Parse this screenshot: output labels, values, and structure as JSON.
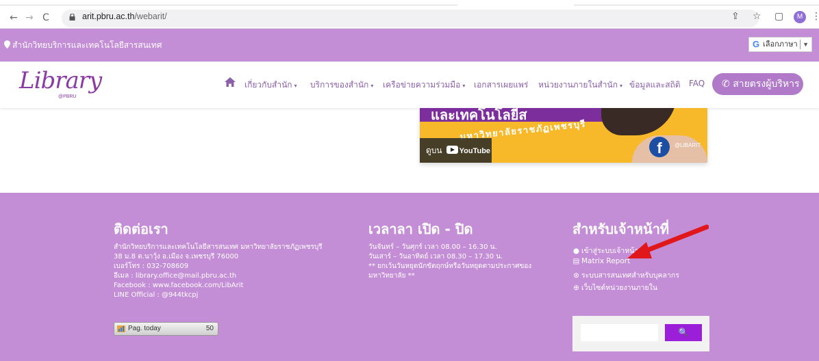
{
  "browser": {
    "url_host": "arit.pbru.ac.th",
    "url_path": "/webarit/",
    "profile_initial": "M"
  },
  "topbar": {
    "title": "สำนักวิทยบริการและเทคโนโลยีสารสนเทศ",
    "language_button": "เลือกภาษา",
    "language_arrow": "▼"
  },
  "nav": {
    "logo": "Library",
    "logo_sub": "@PBRU",
    "items": [
      {
        "label": "เกี่ยวกับสำนัก",
        "dropdown": "▾"
      },
      {
        "label": "บริการของสำนัก",
        "dropdown": "▾"
      },
      {
        "label": "เครือข่ายความร่วมมือ",
        "dropdown": "▾"
      },
      {
        "label": "เอกสารเผยแพร่",
        "dropdown": ""
      },
      {
        "label": "หน่วยงานภายในสำนัก",
        "dropdown": "▾"
      },
      {
        "label": "ข้อมูลและสถิติ",
        "dropdown": ""
      },
      {
        "label": "FAQ",
        "dropdown": ""
      }
    ],
    "hotline": "สายตรงผู้บริหาร"
  },
  "video": {
    "headline": "และเทคโนโลยีส",
    "subtitle": "มหาวิทยาลัยราชภัฏเพชรบุรี",
    "watch_on": "ดูบน",
    "youtube": "YouTube",
    "handle": "@LIBARIT"
  },
  "footer": {
    "contact": {
      "title": "ติดต่อเรา",
      "lines": [
        "สำนักวิทยบริการและเทคโนโลยีสารสนเทศ มหาวิทยาลัยราชภัฏเพชรบุรี",
        "38 ม.8 ต.นาวุ้ง อ.เมือง จ.เพชรบุรี 76000",
        "เบอร์โทร : 032-708609",
        "อีเมล : library.office@mail.pbru.ac.th",
        "Facebook : www.facebook.com/LibArit",
        "LINE Official : @944tkcpj"
      ]
    },
    "hours": {
      "title": "เวลาลา เปิด - ปิด",
      "lines": [
        "วันจันทร์ – วันศุกร์ เวลา 08.00 – 16.30 น.",
        "วันเสาร์ – วันอาทิตย์ เวลา 08.30 – 17.30 น.",
        "** ยกเว้นวันหยุดนักขัตฤกษ์หรือวันหยุดตามประกาศของ",
        "มหาวิทยาลัย **"
      ]
    },
    "staff": {
      "title": "สำหรับเจ้าหน้าที่",
      "links": [
        {
          "icon": "user-icon",
          "label": "เข้าสู่ระบบเจ้าหน้าที่"
        },
        {
          "icon": "report-icon",
          "label": "Matrix Report"
        },
        {
          "icon": "info-system-icon",
          "label": "ระบบสารสนเทศสำหรับบุคลากร"
        },
        {
          "icon": "globe-icon",
          "label": "เว็บไซต์หน่วยงานภายใน"
        }
      ]
    },
    "counter": {
      "label": "Pag. today",
      "value": "50"
    },
    "search": {
      "placeholder": "",
      "button": "🔍"
    }
  },
  "colors": {
    "purple_bar": "#c48ed6",
    "nav_text": "#8a60a8",
    "logo": "#8a3ba3",
    "search_button": "#9b1fd8",
    "annotation_arrow": "#e0181b"
  }
}
